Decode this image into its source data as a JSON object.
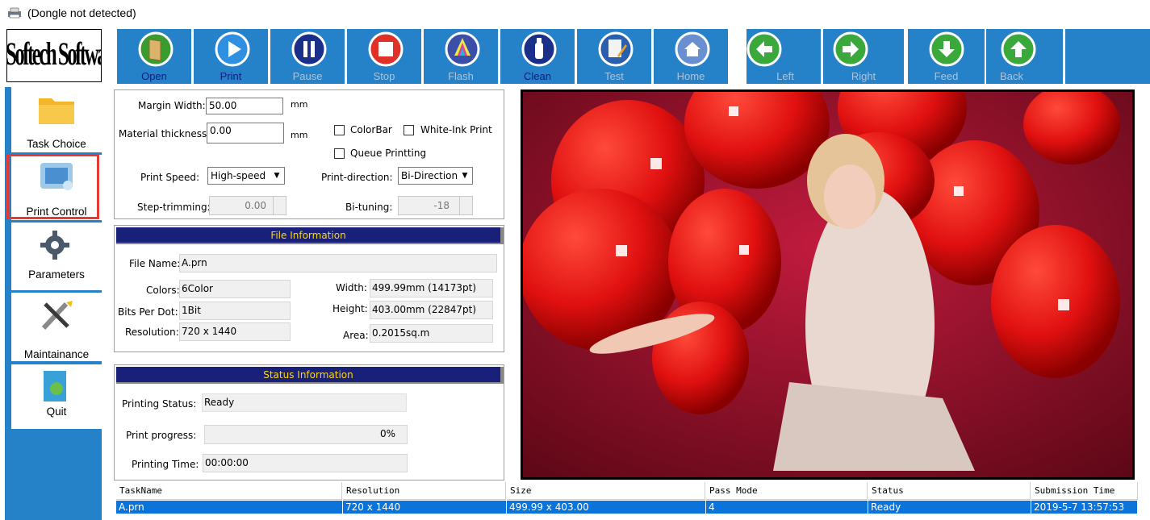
{
  "window": {
    "title": "(Dongle not detected)"
  },
  "logo": {
    "text": "Softech Software"
  },
  "toolbar": {
    "buttons": [
      {
        "label": "Open",
        "icon": "open-book-icon",
        "enabled": true
      },
      {
        "label": "Print",
        "icon": "play-icon",
        "enabled": true
      },
      {
        "label": "Pause",
        "icon": "pause-icon",
        "enabled": false
      },
      {
        "label": "Stop",
        "icon": "stop-icon",
        "enabled": false
      },
      {
        "label": "Flash",
        "icon": "ink-drop-icon",
        "enabled": false
      },
      {
        "label": "Clean",
        "icon": "clean-bottle-icon",
        "enabled": true
      },
      {
        "label": "Test",
        "icon": "test-page-icon",
        "enabled": false
      },
      {
        "label": "Home",
        "icon": "home-icon",
        "enabled": false
      },
      {
        "label": "Left",
        "icon": "arrow-left-icon",
        "enabled": false
      },
      {
        "label": "Right",
        "icon": "arrow-right-icon",
        "enabled": false
      },
      {
        "label": "Feed",
        "icon": "arrow-down-icon",
        "enabled": false
      },
      {
        "label": "Back",
        "icon": "arrow-up-icon",
        "enabled": false
      }
    ]
  },
  "sidebar": {
    "items": [
      {
        "label": "Task Choice",
        "icon": "folder-icon"
      },
      {
        "label": "Print Control",
        "icon": "print-control-icon",
        "selected": true
      },
      {
        "label": "Parameters",
        "icon": "gear-icon"
      },
      {
        "label": "Maintainance",
        "icon": "tools-icon"
      },
      {
        "label": "Quit",
        "icon": "quit-door-icon"
      }
    ]
  },
  "settings": {
    "margin_width_label": "Margin Width:",
    "margin_width_value": "50.00",
    "margin_unit": "mm",
    "material_thickness_label": "Material thickness:",
    "material_thickness_value": "0.00",
    "thickness_unit": "mm",
    "colorbar_label": "ColorBar",
    "white_ink_label": "White-Ink Print",
    "queue_label": "Queue Printting",
    "print_speed_label": "Print Speed:",
    "print_speed_value": "High-speed",
    "print_direction_label": "Print-direction:",
    "print_direction_value": "Bi-Direction",
    "step_trimming_label": "Step-trimming:",
    "step_trimming_value": "0.00",
    "bi_tuning_label": "Bi-tuning:",
    "bi_tuning_value": "-18"
  },
  "file_info": {
    "header": "File Information",
    "file_name_label": "File Name:",
    "file_name": "A.prn",
    "colors_label": "Colors:",
    "colors": "6Color",
    "bits_label": "Bits Per Dot:",
    "bits": "1Bit",
    "resolution_label": "Resolution:",
    "resolution": "720 x 1440",
    "width_label": "Width:",
    "width": "499.99mm (14173pt)",
    "height_label": "Height:",
    "height": "403.00mm (22847pt)",
    "area_label": "Area:",
    "area": "0.2015sq.m"
  },
  "status_info": {
    "header": "Status Information",
    "printing_status_label": "Printing Status:",
    "printing_status": "Ready",
    "progress_label": "Print progress:",
    "progress_text": "0%",
    "progress_fraction": 0,
    "time_label": "Printing Time:",
    "time": "00:00:00"
  },
  "task_table": {
    "columns": [
      "TaskName",
      "Resolution",
      "Size",
      "Pass Mode",
      "Status",
      "Submission Time"
    ],
    "rows": [
      [
        "A.prn",
        "720 x 1440",
        "499.99 x 403.00",
        "4",
        "Ready",
        "2019-5-7 13:57:53"
      ]
    ]
  },
  "colors": {
    "accent_blue": "#2582c9",
    "header_navy": "#18207a",
    "header_text": "#ffd700",
    "selection_red": "#e53935",
    "row_highlight": "#0a74da"
  }
}
